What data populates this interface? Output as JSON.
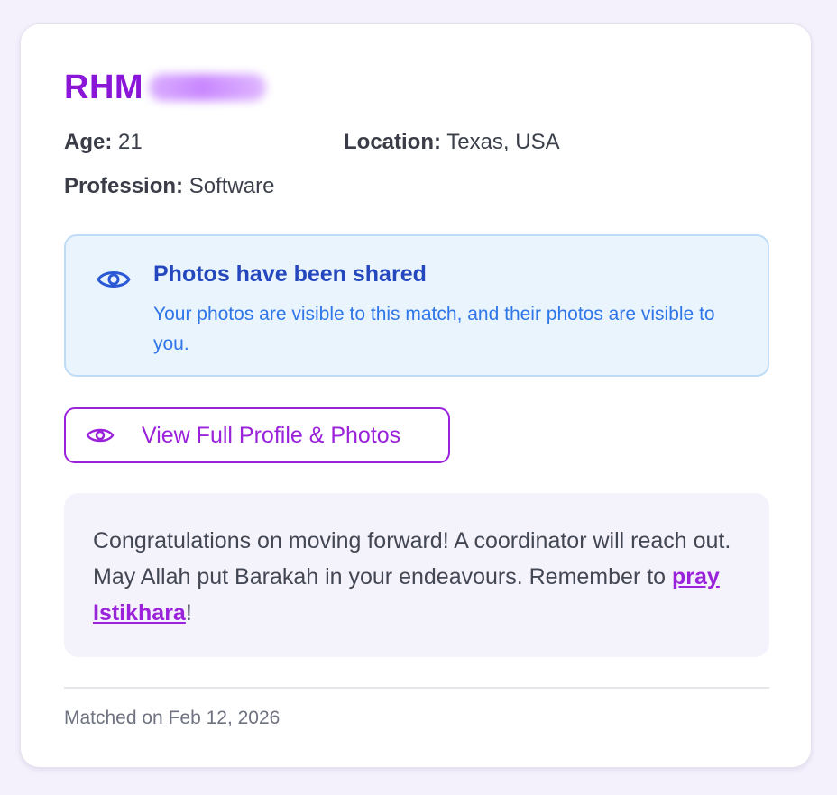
{
  "profile": {
    "name_visible": "RHM",
    "age_label": "Age:",
    "age_value": "21",
    "location_label": "Location:",
    "location_value": "Texas, USA",
    "profession_label": "Profession:",
    "profession_value": "Software"
  },
  "photos_notice": {
    "icon": "eye-icon",
    "title": "Photos have been shared",
    "description": "Your photos are visible to this match, and their photos are visible to you."
  },
  "view_button": {
    "icon": "eye-icon",
    "label": "View Full Profile & Photos"
  },
  "congrats": {
    "text_before": "Congratulations on moving forward! A coordinator will reach out. May Allah put Barakah in your endeavours. Remember to ",
    "link_text": "pray Istikhara",
    "text_after": "!"
  },
  "footer": {
    "matched_text": "Matched on Feb 12, 2026"
  },
  "colors": {
    "accent": "#9a22db",
    "info_title": "#2547bd",
    "info_text": "#2f76e8",
    "info_bg": "#eaf4fd"
  }
}
